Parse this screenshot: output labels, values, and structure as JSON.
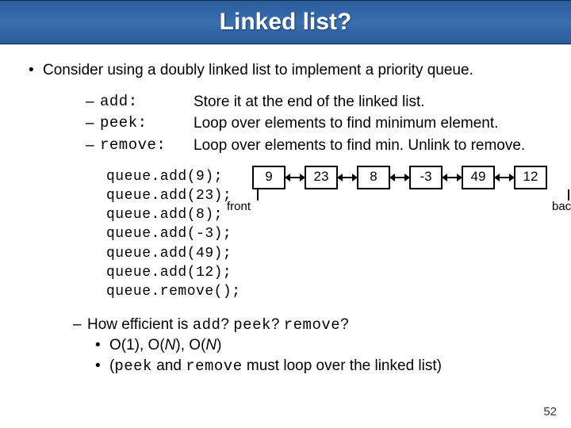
{
  "title": "Linked list?",
  "intro": "Consider using a doubly linked list to implement a priority queue.",
  "ops": [
    {
      "name": "add:",
      "desc": "Store it at the end of the linked list."
    },
    {
      "name": "peek:",
      "desc": "Loop over elements to find minimum element."
    },
    {
      "name": "remove:",
      "desc": "Loop over elements to find min.  Unlink to remove."
    }
  ],
  "code": [
    "queue.add(9);",
    "queue.add(23);",
    "queue.add(8);",
    "queue.add(-3);",
    "queue.add(49);",
    "queue.add(12);",
    "queue.remove();"
  ],
  "nodes": [
    "9",
    "23",
    "8",
    "-3",
    "49",
    "12"
  ],
  "labels": {
    "front": "front",
    "back": "back"
  },
  "question": {
    "prefix": "How efficient is ",
    "q1": "add",
    "q2": "peek",
    "q3": "remove",
    "ans_o1": "O(1), O(",
    "ans_n1": "N",
    "ans_mid": "), O(",
    "ans_n2": "N",
    "ans_end": ")",
    "note_open": "(",
    "note_a": "peek",
    "note_mid": " and ",
    "note_b": "remove",
    "note_rest": " must loop over the linked list)"
  },
  "page": "52"
}
